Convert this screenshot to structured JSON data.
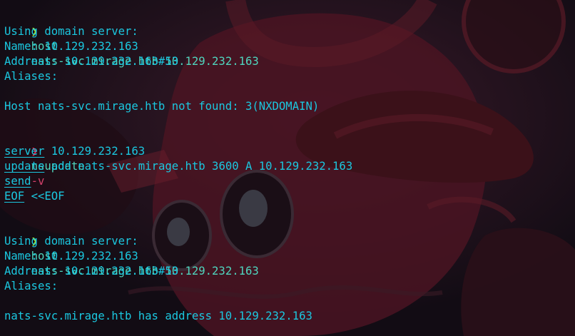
{
  "colors": {
    "prompt_ok": "#a6e22e",
    "prompt_err": "#e6194b",
    "command": "#4fd6be",
    "output": "#1bc7df",
    "flag": "#d3416a"
  },
  "terminal": {
    "prompt_glyph": "❯",
    "block1": {
      "cmd": "host",
      "args": "nats-svc.mirage.htb 10.129.232.163",
      "out1": "Using domain server:",
      "out2": "Name: 10.129.232.163",
      "out3": "Address: 10.129.232.163#53",
      "out4": "Aliases:",
      "result": "Host nats-svc.mirage.htb not found: 3(NXDOMAIN)"
    },
    "block2": {
      "cmd": "nsupdate",
      "flag": "-v",
      "heredoc": "<<EOF",
      "l1_kw": "server",
      "l1_rest": " 10.129.232.163",
      "l2_kw": "update",
      "l2_rest": " add nats-svc.mirage.htb 3600 A 10.129.232.163",
      "l3_kw": "send",
      "l4_kw": "EOF"
    },
    "block3": {
      "cmd": "host",
      "args": "nats-svc.mirage.htb 10.129.232.163",
      "out1": "Using domain server:",
      "out2": "Name: 10.129.232.163",
      "out3": "Address: 10.129.232.163#53",
      "out4": "Aliases:",
      "result": "nats-svc.mirage.htb has address 10.129.232.163"
    }
  }
}
